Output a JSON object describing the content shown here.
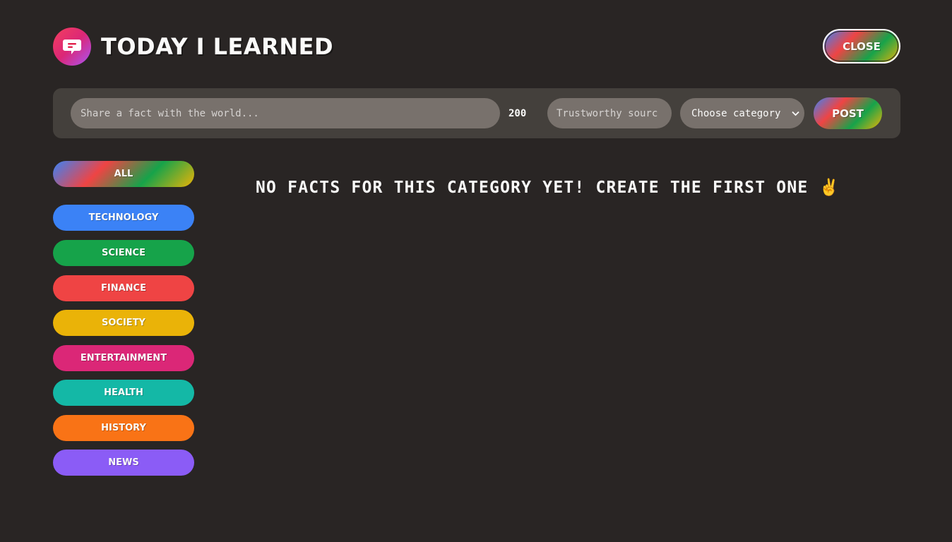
{
  "header": {
    "title": "Today I Learned",
    "close_label": "Close"
  },
  "form": {
    "fact_placeholder": "Share a fact with the world...",
    "char_count": "200",
    "source_placeholder": "Trustworthy sourc",
    "category_selected": "Choose category",
    "post_label": "Post"
  },
  "sidebar": {
    "all_label": "All",
    "categories": [
      {
        "label": "Technology",
        "color": "#3b82f6"
      },
      {
        "label": "Science",
        "color": "#16a34a"
      },
      {
        "label": "Finance",
        "color": "#ef4444"
      },
      {
        "label": "Society",
        "color": "#eab308"
      },
      {
        "label": "Entertainment",
        "color": "#db2777"
      },
      {
        "label": "Health",
        "color": "#14b8a6"
      },
      {
        "label": "History",
        "color": "#f97316"
      },
      {
        "label": "News",
        "color": "#8b5cf6"
      }
    ]
  },
  "main": {
    "empty_message": "No facts for this category yet! Create the first one ✌️"
  }
}
